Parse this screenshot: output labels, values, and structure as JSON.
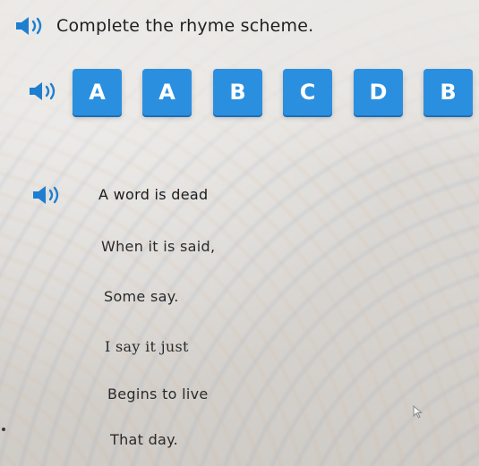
{
  "prompt": {
    "text": "Complete the rhyme scheme."
  },
  "tiles": {
    "items": [
      {
        "label": "A"
      },
      {
        "label": "A"
      },
      {
        "label": "B"
      },
      {
        "label": "C"
      },
      {
        "label": "D"
      },
      {
        "label": "B"
      }
    ]
  },
  "poem": {
    "lines": [
      {
        "text": "A word is dead"
      },
      {
        "text": "When it is said,"
      },
      {
        "text": "Some say."
      },
      {
        "text": "I say it just"
      },
      {
        "text": "Begins to live"
      },
      {
        "text": "That day."
      }
    ]
  },
  "icons": {
    "speaker": "speaker-icon",
    "cursor": "mouse-pointer-icon"
  },
  "colors": {
    "tile_blue": "#2b8fe0",
    "icon_blue": "#1e7fd0",
    "text_dark": "#1f1f1f"
  }
}
